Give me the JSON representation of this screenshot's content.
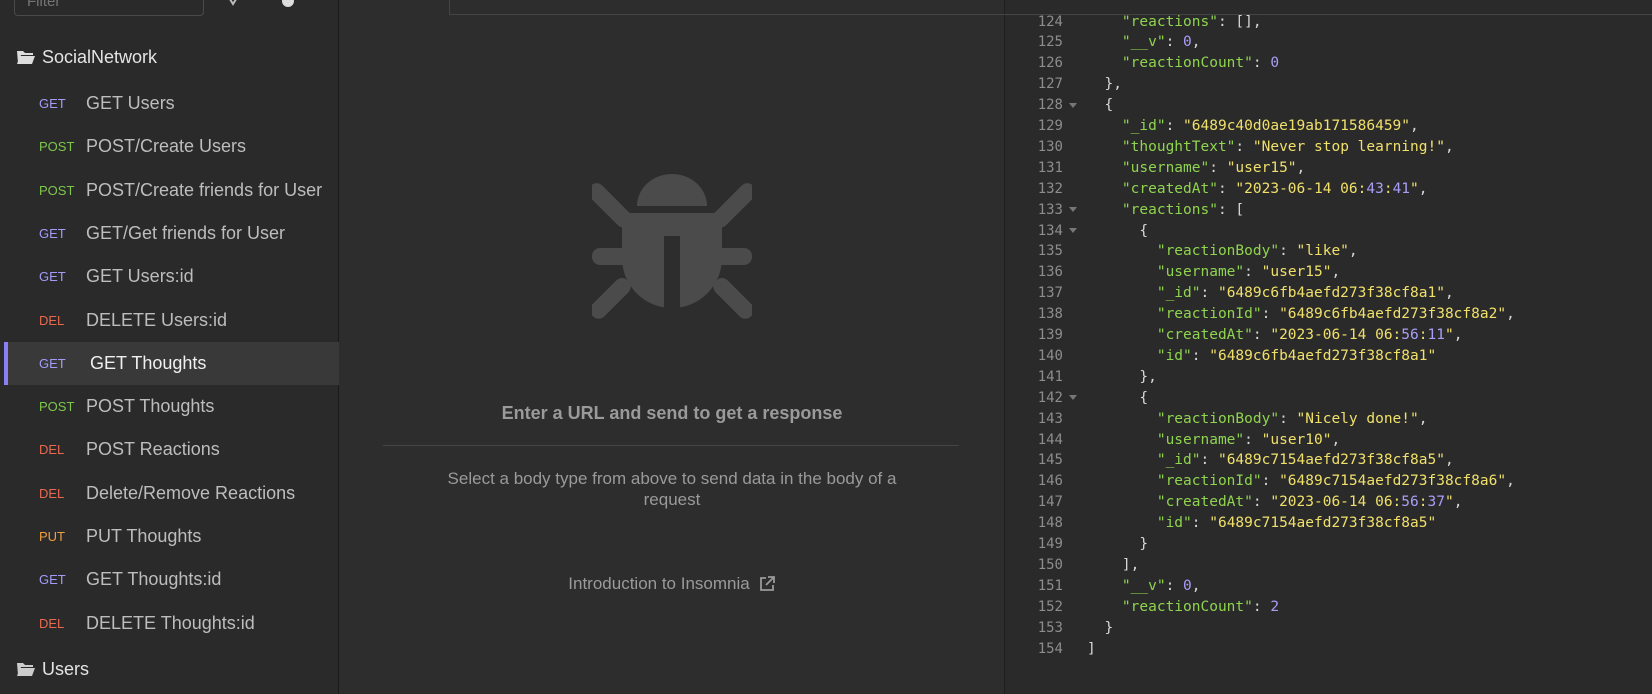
{
  "sidebar": {
    "filter_placeholder": "Filter",
    "folder_name": "SocialNetwork",
    "requests": [
      {
        "method": "GET",
        "name": "GET Users"
      },
      {
        "method": "POST",
        "name": "POST/Create Users"
      },
      {
        "method": "POST",
        "name": "POST/Create friends for User"
      },
      {
        "method": "GET",
        "name": "GET/Get friends for User"
      },
      {
        "method": "GET",
        "name": "GET Users:id"
      },
      {
        "method": "DEL",
        "name": "DELETE Users:id"
      },
      {
        "method": "GET",
        "name": "GET Thoughts"
      },
      {
        "method": "POST",
        "name": "POST Thoughts"
      },
      {
        "method": "DEL",
        "name": "POST Reactions"
      },
      {
        "method": "DEL",
        "name": "Delete/Remove Reactions"
      },
      {
        "method": "PUT",
        "name": "PUT Thoughts"
      },
      {
        "method": "GET",
        "name": "GET Thoughts:id"
      },
      {
        "method": "DEL",
        "name": "DELETE Thoughts:id"
      }
    ],
    "active_index": 6,
    "second_folder": "Users"
  },
  "request_body": {
    "empty_title": "Enter a URL and send to get a response",
    "empty_description": "Select a body type from above to send data in the body of a request",
    "intro_link": "Introduction to Insomnia"
  },
  "response": {
    "lines": [
      {
        "n": "124",
        "fold": false,
        "text": "    \"reactions\": [],"
      },
      {
        "n": "125",
        "fold": false,
        "text": "    \"__v\": 0,"
      },
      {
        "n": "126",
        "fold": false,
        "text": "    \"reactionCount\": 0"
      },
      {
        "n": "127",
        "fold": false,
        "text": "  },"
      },
      {
        "n": "128",
        "fold": true,
        "text": "  {"
      },
      {
        "n": "129",
        "fold": false,
        "text": "    \"_id\": \"6489c40d0ae19ab171586459\","
      },
      {
        "n": "130",
        "fold": false,
        "text": "    \"thoughtText\": \"Never stop learning!\","
      },
      {
        "n": "131",
        "fold": false,
        "text": "    \"username\": \"user15\","
      },
      {
        "n": "132",
        "fold": false,
        "text": "    \"createdAt\": \"2023-06-14 06:43:41\","
      },
      {
        "n": "133",
        "fold": true,
        "text": "    \"reactions\": ["
      },
      {
        "n": "134",
        "fold": true,
        "text": "      {"
      },
      {
        "n": "135",
        "fold": false,
        "text": "        \"reactionBody\": \"like\","
      },
      {
        "n": "136",
        "fold": false,
        "text": "        \"username\": \"user15\","
      },
      {
        "n": "137",
        "fold": false,
        "text": "        \"_id\": \"6489c6fb4aefd273f38cf8a1\","
      },
      {
        "n": "138",
        "fold": false,
        "text": "        \"reactionId\": \"6489c6fb4aefd273f38cf8a2\","
      },
      {
        "n": "139",
        "fold": false,
        "text": "        \"createdAt\": \"2023-06-14 06:56:11\","
      },
      {
        "n": "140",
        "fold": false,
        "text": "        \"id\": \"6489c6fb4aefd273f38cf8a1\""
      },
      {
        "n": "141",
        "fold": false,
        "text": "      },"
      },
      {
        "n": "142",
        "fold": true,
        "text": "      {"
      },
      {
        "n": "143",
        "fold": false,
        "text": "        \"reactionBody\": \"Nicely done!\","
      },
      {
        "n": "144",
        "fold": false,
        "text": "        \"username\": \"user10\","
      },
      {
        "n": "145",
        "fold": false,
        "text": "        \"_id\": \"6489c7154aefd273f38cf8a5\","
      },
      {
        "n": "146",
        "fold": false,
        "text": "        \"reactionId\": \"6489c7154aefd273f38cf8a6\","
      },
      {
        "n": "147",
        "fold": false,
        "text": "        \"createdAt\": \"2023-06-14 06:56:37\","
      },
      {
        "n": "148",
        "fold": false,
        "text": "        \"id\": \"6489c7154aefd273f38cf8a5\""
      },
      {
        "n": "149",
        "fold": false,
        "text": "      }"
      },
      {
        "n": "150",
        "fold": false,
        "text": "    ],"
      },
      {
        "n": "151",
        "fold": false,
        "text": "    \"__v\": 0,"
      },
      {
        "n": "152",
        "fold": false,
        "text": "    \"reactionCount\": 2"
      },
      {
        "n": "153",
        "fold": false,
        "text": "  }"
      },
      {
        "n": "154",
        "fold": false,
        "text": "]"
      }
    ]
  },
  "colors": {
    "get": "#a39bf7",
    "post": "#7ec74d",
    "del": "#e8694f",
    "put": "#f0a040",
    "json_key": "#8fd44f",
    "json_string": "#f0e06a",
    "json_number": "#a99ef7"
  },
  "icons": [
    "folder-open-icon",
    "bug-icon",
    "external-link-icon",
    "fold-arrow-icon",
    "cookie-icon",
    "gear-icon"
  ]
}
